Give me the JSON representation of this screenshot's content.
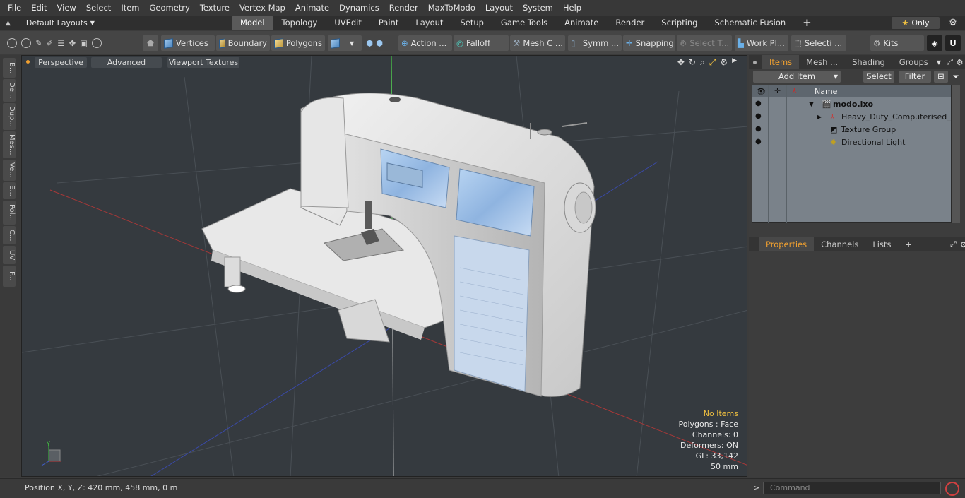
{
  "menu": [
    "File",
    "Edit",
    "View",
    "Select",
    "Item",
    "Geometry",
    "Texture",
    "Vertex Map",
    "Animate",
    "Dynamics",
    "Render",
    "MaxToModo",
    "Layout",
    "System",
    "Help"
  ],
  "layout": {
    "selector": "Default Layouts",
    "tabs": [
      "Model",
      "Topology",
      "UVEdit",
      "Paint",
      "Layout",
      "Setup",
      "Game Tools",
      "Animate",
      "Render",
      "Scripting",
      "Schematic Fusion"
    ],
    "active_tab": "Model",
    "add_tab": "+",
    "only_label": "Only"
  },
  "toolbar": {
    "vertices": "Vertices",
    "boundary": "Boundary",
    "polygons": "Polygons",
    "action": "Action ...",
    "falloff": "Falloff",
    "mesh": "Mesh C ...",
    "symm": "Symm ...",
    "snapping": "Snapping",
    "select_t": "Select T...",
    "work_pl": "Work Pl...",
    "selecti": "Selecti ...",
    "kits": "Kits"
  },
  "left_tabs": [
    "B...",
    "De...",
    "Dup...",
    "Mes...",
    "Ve...",
    "E...",
    "Pol...",
    "C...",
    "UV",
    "F..."
  ],
  "viewport": {
    "perspective": "Perspective",
    "advanced": "Advanced",
    "textures": "Viewport Textures",
    "info": {
      "no_items": "No Items",
      "polygons": "Polygons : Face",
      "channels": "Channels: 0",
      "deformers": "Deformers: ON",
      "gl": "GL: 33,142",
      "scale": "50 mm"
    }
  },
  "items_panel": {
    "tabs": [
      "Items",
      "Mesh ...",
      "Shading",
      "Groups"
    ],
    "add_item": "Add Item",
    "select": "Select",
    "filter": "Filter",
    "col_name": "Name",
    "rows": [
      "modo.lxo",
      "Heavy_Duty_Computerised_ ...",
      "Texture Group",
      "Directional Light"
    ]
  },
  "props_panel": {
    "tabs": [
      "Properties",
      "Channels",
      "Lists"
    ],
    "add": "+"
  },
  "status": {
    "position": "Position X, Y, Z:   420 mm, 458 mm, 0 m",
    "command_placeholder": "Command"
  }
}
